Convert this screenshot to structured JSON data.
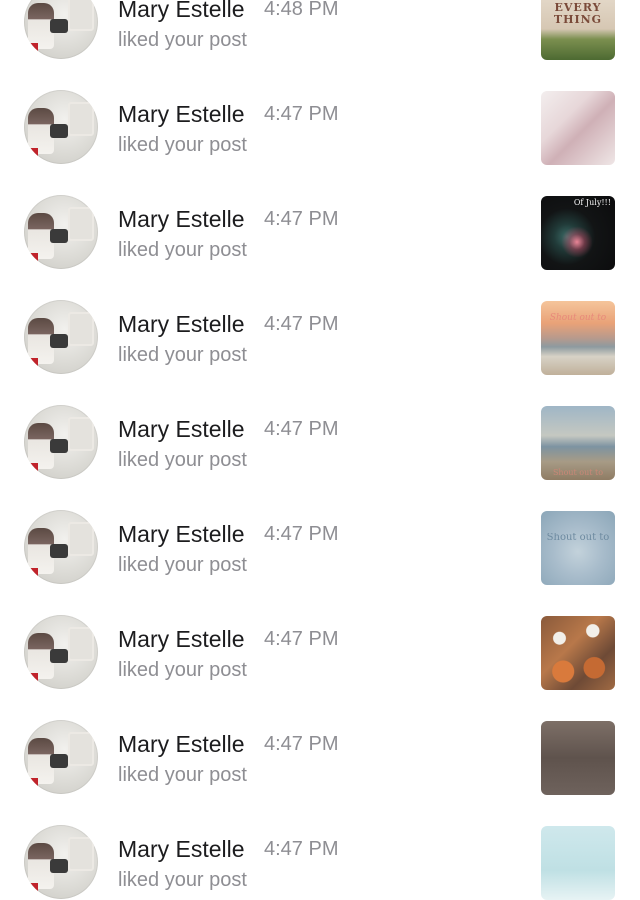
{
  "notifications": [
    {
      "name": "Mary Estelle",
      "time": "4:48 PM",
      "action": "liked your post",
      "thumb_caption": "OVER EVERY THING",
      "thumb_style": "t-over"
    },
    {
      "name": "Mary Estelle",
      "time": "4:47 PM",
      "action": "liked your post",
      "thumb_caption": "",
      "thumb_style": "t-pink"
    },
    {
      "name": "Mary Estelle",
      "time": "4:47 PM",
      "action": "liked your post",
      "thumb_caption": "Of July!!!",
      "thumb_style": "t-fire"
    },
    {
      "name": "Mary Estelle",
      "time": "4:47 PM",
      "action": "liked your post",
      "thumb_caption": "Shout out to",
      "thumb_style": "t-sunset"
    },
    {
      "name": "Mary Estelle",
      "time": "4:47 PM",
      "action": "liked your post",
      "thumb_caption": "Shout out to",
      "thumb_style": "t-beach"
    },
    {
      "name": "Mary Estelle",
      "time": "4:47 PM",
      "action": "liked your post",
      "thumb_caption": "Shout out to",
      "thumb_style": "t-blue"
    },
    {
      "name": "Mary Estelle",
      "time": "4:47 PM",
      "action": "liked your post",
      "thumb_caption": "",
      "thumb_style": "t-leaves"
    },
    {
      "name": "Mary Estelle",
      "time": "4:47 PM",
      "action": "liked your post",
      "thumb_caption": "",
      "thumb_style": "t-rain"
    },
    {
      "name": "Mary Estelle",
      "time": "4:47 PM",
      "action": "liked your post",
      "thumb_caption": "",
      "thumb_style": "t-light"
    }
  ]
}
